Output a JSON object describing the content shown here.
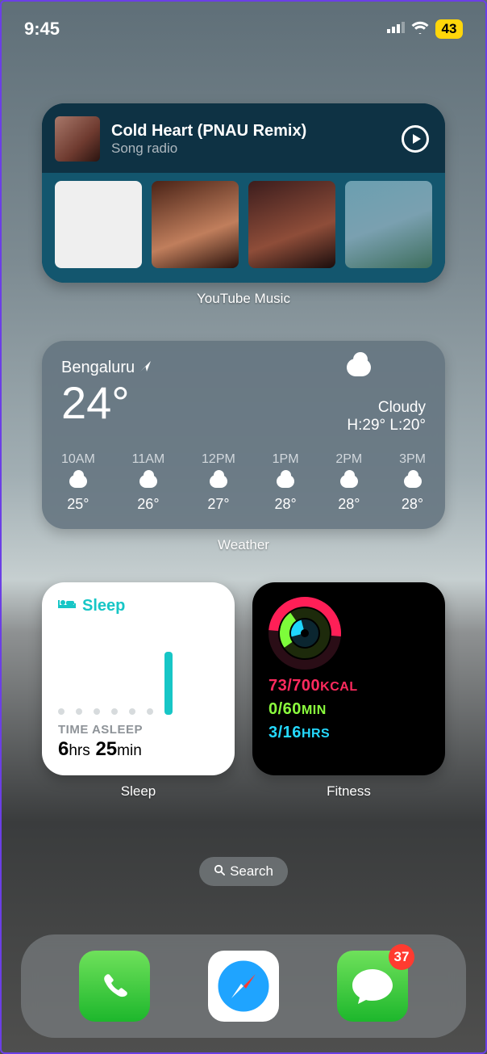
{
  "status": {
    "time": "9:45",
    "battery": "43"
  },
  "ytmusic": {
    "title": "Cold Heart (PNAU Remix)",
    "subtitle": "Song radio",
    "label": "YouTube Music"
  },
  "weather": {
    "location": "Bengaluru",
    "temp": "24°",
    "condition": "Cloudy",
    "range": "H:29° L:20°",
    "label": "Weather",
    "hours": [
      {
        "label": "10AM",
        "temp": "25°"
      },
      {
        "label": "11AM",
        "temp": "26°"
      },
      {
        "label": "12PM",
        "temp": "27°"
      },
      {
        "label": "1PM",
        "temp": "28°"
      },
      {
        "label": "2PM",
        "temp": "28°"
      },
      {
        "label": "3PM",
        "temp": "28°"
      }
    ]
  },
  "sleep": {
    "header": "Sleep",
    "metric_label": "TIME ASLEEP",
    "hours_n": "6",
    "hours_u": "hrs",
    "mins_n": "25",
    "mins_u": "min",
    "label": "Sleep"
  },
  "fitness": {
    "move": {
      "value": "73/700",
      "unit": "KCAL"
    },
    "ex": {
      "value": "0/60",
      "unit": "MIN"
    },
    "stand": {
      "value": "3/16",
      "unit": "HRS"
    },
    "label": "Fitness"
  },
  "search": {
    "label": "Search"
  },
  "dock": {
    "messages_badge": "37"
  }
}
